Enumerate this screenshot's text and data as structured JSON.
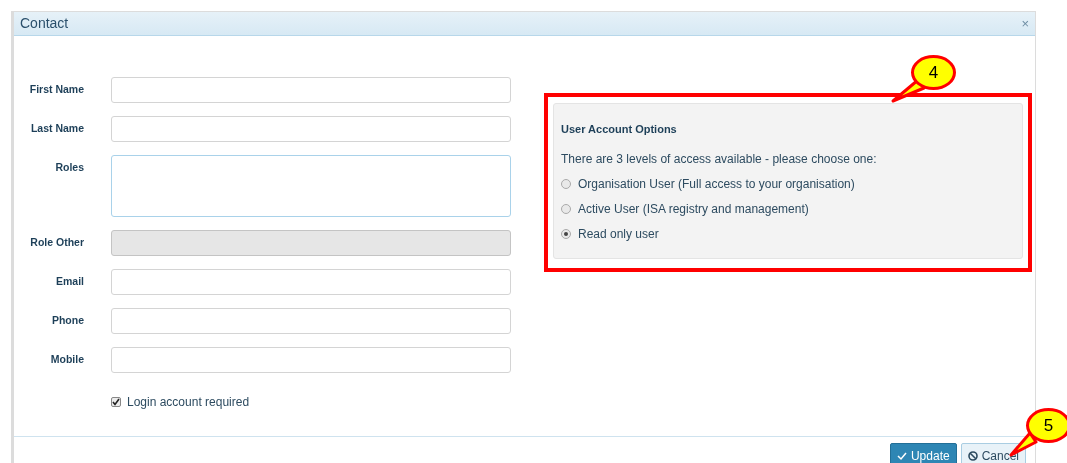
{
  "dialog": {
    "title": "Contact",
    "close": "×"
  },
  "fields": [
    {
      "label": "First Name",
      "kind": "text",
      "disabled": false
    },
    {
      "label": "Last Name",
      "kind": "text",
      "disabled": false
    },
    {
      "label": "Roles",
      "kind": "textarea",
      "disabled": false
    },
    {
      "label": "Role Other",
      "kind": "text",
      "disabled": true
    },
    {
      "label": "Email",
      "kind": "text",
      "disabled": false
    },
    {
      "label": "Phone",
      "kind": "text",
      "disabled": false
    },
    {
      "label": "Mobile",
      "kind": "text",
      "disabled": false
    }
  ],
  "login_checkbox": {
    "label": "Login account required",
    "checked": true
  },
  "account_options": {
    "title": "User Account Options",
    "description": "There are 3 levels of access available - please choose one:",
    "options": [
      {
        "label": "Organisation User (Full access to your organisation)",
        "selected": false
      },
      {
        "label": "Active User (ISA registry and management)",
        "selected": false
      },
      {
        "label": "Read only user",
        "selected": true
      }
    ]
  },
  "buttons": [
    {
      "label": "Update",
      "kind": "primary"
    },
    {
      "label": "Cancel",
      "kind": "secondary"
    }
  ],
  "callouts": [
    "4",
    "5"
  ]
}
